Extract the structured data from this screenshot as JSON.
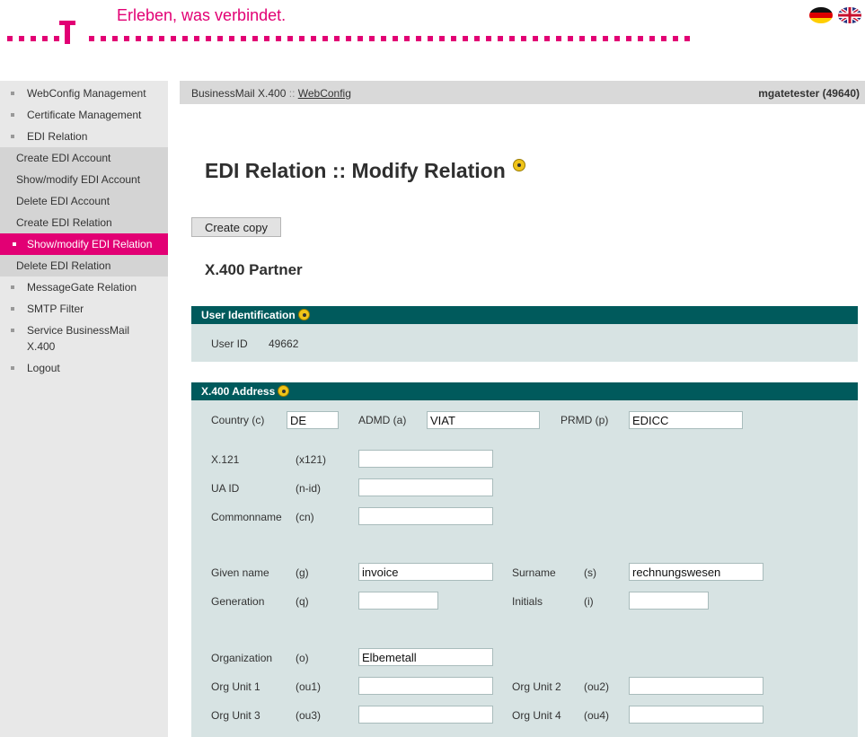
{
  "header": {
    "slogan": "Erleben, was verbindet.",
    "brand_color": "#e20074"
  },
  "sidebar": {
    "items": [
      {
        "label": "WebConfig Management"
      },
      {
        "label": "Certificate Management"
      },
      {
        "label": "EDI Relation"
      }
    ],
    "sub_items": [
      {
        "label": "Create EDI Account"
      },
      {
        "label": "Show/modify EDI Account"
      },
      {
        "label": "Delete EDI Account"
      },
      {
        "label": "Create EDI Relation"
      },
      {
        "label": "Show/modify EDI Relation",
        "active": true
      },
      {
        "label": "Delete EDI Relation"
      }
    ],
    "items_after": [
      {
        "label": "MessageGate Relation"
      },
      {
        "label": "SMTP Filter"
      },
      {
        "label": "Service BusinessMail X.400"
      },
      {
        "label": "Logout"
      }
    ]
  },
  "topbar": {
    "crumb_prefix": "BusinessMail X.400",
    "crumb_sep": "::",
    "crumb_link": "WebConfig",
    "user": "mgatetester (49640)"
  },
  "page": {
    "title": "EDI Relation :: Modify Relation",
    "copy_button": "Create copy",
    "section": "X.400 Partner"
  },
  "user_identification": {
    "heading": "User Identification",
    "label": "User ID",
    "value": "49662"
  },
  "x400_address": {
    "heading": "X.400 Address",
    "country_label": "Country (c)",
    "country_value": "DE",
    "admd_label": "ADMD (a)",
    "admd_value": "VIAT",
    "prmd_label": "PRMD (p)",
    "prmd_value": "EDICC",
    "x121_label": "X.121",
    "x121_abbr": "(x121)",
    "x121_value": "",
    "uaid_label": "UA ID",
    "uaid_abbr": "(n-id)",
    "uaid_value": "",
    "cn_label": "Commonname",
    "cn_abbr": "(cn)",
    "cn_value": "",
    "given_label": "Given name",
    "given_abbr": "(g)",
    "given_value": "invoice",
    "surname_label": "Surname",
    "surname_abbr": "(s)",
    "surname_value": "rechnungswesen",
    "generation_label": "Generation",
    "generation_abbr": "(q)",
    "generation_value": "",
    "initials_label": "Initials",
    "initials_abbr": "(i)",
    "initials_value": "",
    "org_label": "Organization",
    "org_abbr": "(o)",
    "org_value": "Elbemetall",
    "ou1_label": "Org Unit 1",
    "ou1_abbr": "(ou1)",
    "ou1_value": "",
    "ou2_label": "Org Unit 2",
    "ou2_abbr": "(ou2)",
    "ou2_value": "",
    "ou3_label": "Org Unit 3",
    "ou3_abbr": "(ou3)",
    "ou3_value": "",
    "ou4_label": "Org Unit 4",
    "ou4_abbr": "(ou4)",
    "ou4_value": ""
  },
  "colors": {
    "magenta": "#e20074",
    "panel_header": "#005a5c",
    "panel_body": "#d7e3e3",
    "sidebar": "#e8e8e8"
  }
}
